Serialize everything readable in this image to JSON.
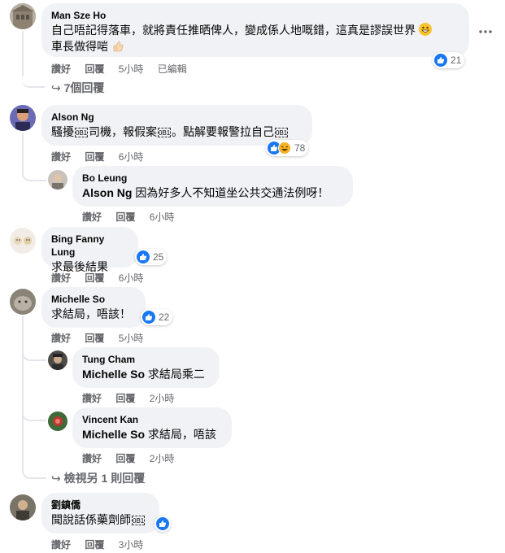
{
  "actions": {
    "like": "讚好",
    "reply": "回覆",
    "edited": "已編輯"
  },
  "colors": {
    "like_blue": "#1877f2",
    "meta_gray": "#65676b",
    "bubble_bg": "#f0f2f5"
  },
  "comments": [
    {
      "author": "Man Sze Ho",
      "text_line1": "自己唔記得落車，就將責任推晒俾人，變成係人地嘅錯，這真是謬誤世界",
      "text_line2": "車長做得啱",
      "time": "5小時",
      "reactions": "21",
      "more_replies": "7個回覆",
      "more_icon": "ellipsis-icon"
    },
    {
      "author": "Alson Ng",
      "text_a": "騷擾",
      "text_b": "司機，報假案",
      "text_c": "。點解要報警拉自己",
      "time": "6小時",
      "reactions": "78",
      "replies": [
        {
          "author": "Bo Leung",
          "mention": "Alson Ng",
          "text": " 因為好多人不知道坐公共交通法例呀！",
          "time": "6小時"
        }
      ]
    },
    {
      "author": "Bing Fanny Lung",
      "text": "求最後結果",
      "time": "6小時",
      "reactions": "25"
    },
    {
      "author": "Michelle So",
      "text": "求結局，唔該！",
      "time": "5小時",
      "reactions": "22",
      "replies": [
        {
          "author": "Tung Cham",
          "mention": "Michelle So",
          "text": " 求結局乘二",
          "time": "2小時"
        },
        {
          "author": "Vincent Kan",
          "mention": "Michelle So",
          "text": " 求結局，唔該",
          "time": "2小時"
        }
      ],
      "more_replies": "檢視另 1 則回覆"
    },
    {
      "author": "劉鎮僑",
      "text_a": "聞說話係藥劑師",
      "time": "3小時"
    }
  ],
  "emoji_placeholder": "0B1"
}
